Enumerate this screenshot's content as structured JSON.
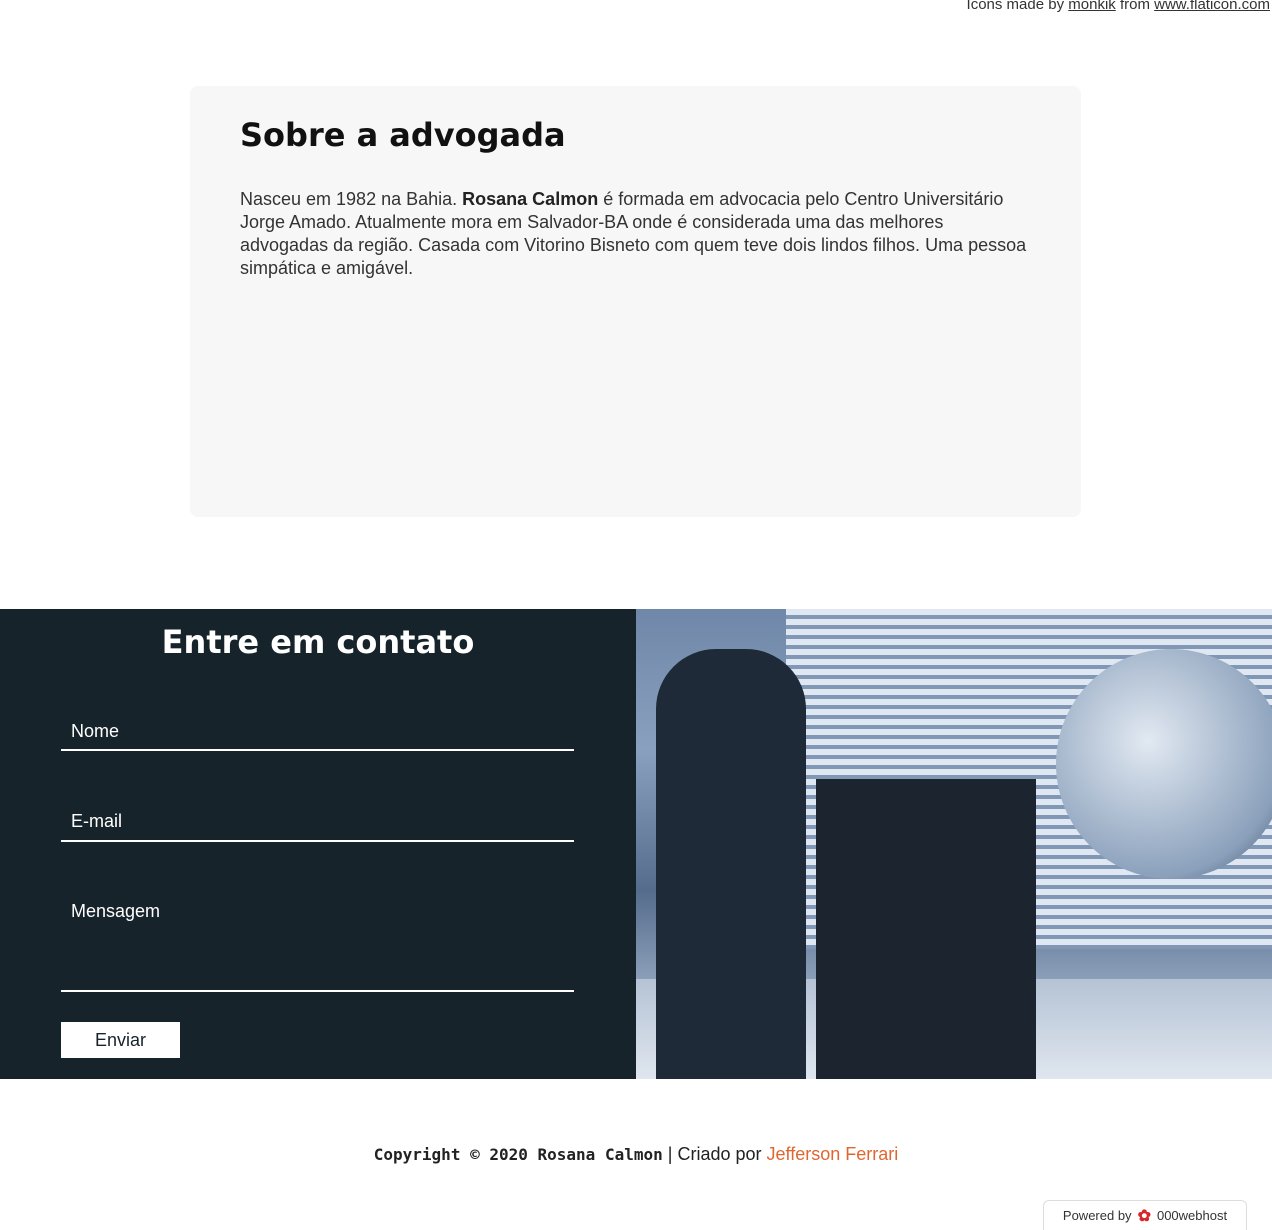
{
  "credits": {
    "prefix": "Icons made by",
    "author": "monkik",
    "from": "from",
    "site": "www.flaticon.com"
  },
  "about": {
    "title": "Sobre a advogada",
    "text_before": "Nasceu em 1982 na Bahia. ",
    "name": "Rosana Calmon",
    "text_after": " é formada em advocacia pelo Centro Universitário Jorge Amado. Atualmente mora em Salvador-BA onde é considerada uma das melhores advogadas da região. Casada com Vitorino Bisneto com quem teve dois lindos filhos. Uma pessoa simpática e amigável."
  },
  "contact": {
    "title": "Entre em contato",
    "name_placeholder": "Nome",
    "email_placeholder": "E-mail",
    "message_placeholder": "Mensagem",
    "submit": "Enviar"
  },
  "footer": {
    "copyright": "Copyright © 2020 Rosana Calmon",
    "separator": "|",
    "created_by": "Criado por",
    "author": "Jefferson Ferrari"
  },
  "powered": {
    "label": "Powered by",
    "brand": "000webhost"
  }
}
